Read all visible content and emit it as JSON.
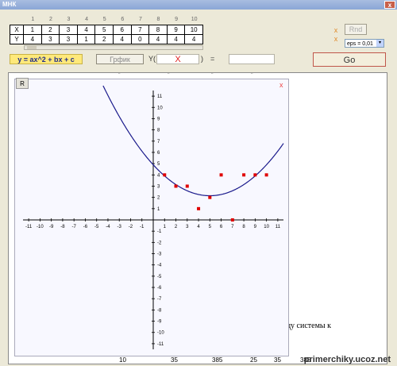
{
  "window": {
    "title": "МНК",
    "close_label": "x"
  },
  "table": {
    "column_numbers": [
      "1",
      "2",
      "3",
      "4",
      "5",
      "6",
      "7",
      "8",
      "9",
      "10"
    ],
    "row_x_label": "X",
    "row_y_label": "Y",
    "x_values": [
      "1",
      "2",
      "3",
      "4",
      "5",
      "6",
      "7",
      "8",
      "9",
      "10"
    ],
    "y_values": [
      "4",
      "3",
      "3",
      "1",
      "2",
      "4",
      "0",
      "4",
      "4",
      "4"
    ]
  },
  "side": {
    "x1": "x",
    "x2": "x",
    "rnd_label": "Rnd",
    "eps_value": "eps = 0,01",
    "eps_arrow": "▾"
  },
  "formula_label": "y = ax^2 + bx + c",
  "graph_button_label": "Грфик",
  "y_label": "Y(",
  "y_input_value": "X",
  "y_close": ")",
  "equals_label": "=",
  "go_button_label": "Go",
  "plot": {
    "reset_label": "R",
    "close_label": "x"
  },
  "doc": {
    "text_fragment": "ницу системы к",
    "bottom_row": [
      "10",
      "35",
      "385",
      "25",
      "35",
      "385"
    ],
    "watermark": "primerchiky.ucoz.net"
  },
  "chart_data": {
    "type": "scatter",
    "x_ticks": [
      "-11",
      "-10",
      "-9",
      "-8",
      "-7",
      "-6",
      "-5",
      "-4",
      "-3",
      "-2",
      "-1",
      "1",
      "2",
      "3",
      "4",
      "5",
      "6",
      "7",
      "8",
      "9",
      "10",
      "11"
    ],
    "y_ticks": [
      "11",
      "10",
      "9",
      "8",
      "7",
      "6",
      "5",
      "4",
      "3",
      "2",
      "1",
      "-1",
      "-2",
      "-3",
      "-4",
      "-5",
      "-6",
      "-7",
      "-8",
      "-9",
      "-10",
      "-11"
    ],
    "xlim": [
      -11.5,
      11.5
    ],
    "ylim": [
      -11.5,
      11.5
    ],
    "points": [
      [
        1,
        4
      ],
      [
        2,
        3
      ],
      [
        3,
        3
      ],
      [
        4,
        1
      ],
      [
        5,
        2
      ],
      [
        6,
        4
      ],
      [
        7,
        0
      ],
      [
        8,
        4
      ],
      [
        9,
        4
      ],
      [
        10,
        4
      ]
    ],
    "curve": {
      "a": 0.11,
      "b": -1.1,
      "c": 4.9
    },
    "point_color": "#e00000",
    "curve_color": "#1a1a8c"
  }
}
